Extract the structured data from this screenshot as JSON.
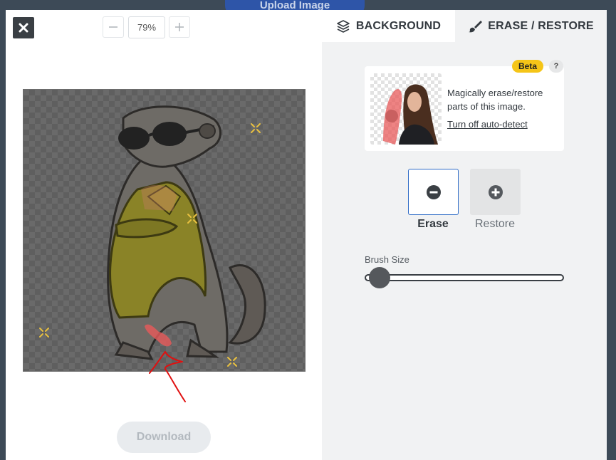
{
  "backdrop": {
    "upload_label": "Upload Image"
  },
  "toolbar": {
    "zoom_value": "79%"
  },
  "tabs": {
    "background": "BACKGROUND",
    "erase_restore": "ERASE / RESTORE"
  },
  "info": {
    "beta": "Beta",
    "help": "?",
    "description": "Magically erase/restore parts of this image.",
    "link": "Turn off auto-detect"
  },
  "modes": {
    "erase": "Erase",
    "restore": "Restore",
    "active": "erase"
  },
  "brush": {
    "label": "Brush Size",
    "value": 0.05
  },
  "actions": {
    "download": "Download"
  },
  "colors": {
    "accent": "#2e6bc6",
    "beta": "#f5c518",
    "brush_mark": "#e85a5a",
    "annotation": "#e01010"
  },
  "icons": [
    "close-icon",
    "minus-icon",
    "plus-icon",
    "layers-icon",
    "brush-icon",
    "minus-circle-icon",
    "plus-circle-icon"
  ]
}
